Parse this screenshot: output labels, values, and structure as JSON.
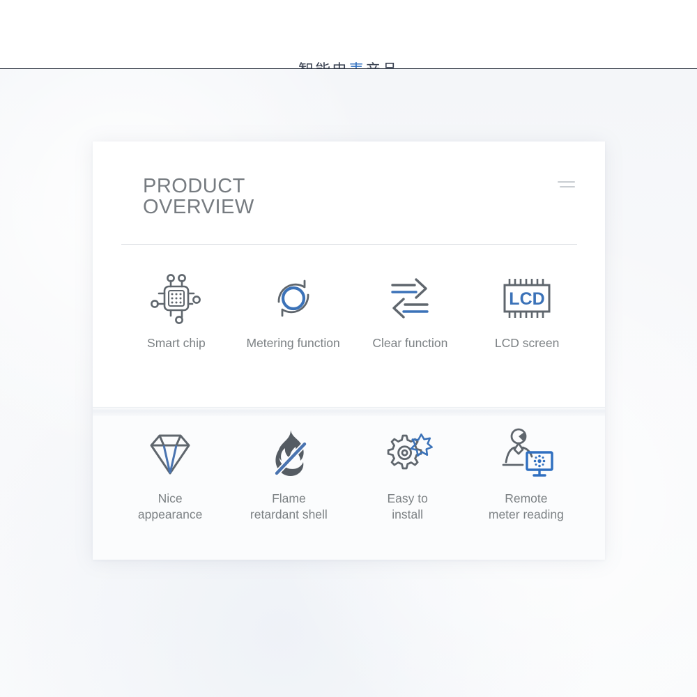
{
  "top_banner": {
    "text_prefix": "智能电",
    "text_highlight": "表",
    "text_suffix": "产品",
    "note": "cropped-banner"
  },
  "card": {
    "title_line_1": "PRODUCT",
    "title_line_2": "OVERVIEW",
    "menu_icon": "menu-icon",
    "colors": {
      "card_background": "#ffffff",
      "page_background": "#f7f8fa",
      "title_text": "#767b80",
      "label_text": "#7c8184",
      "divider": "#dcdfe3",
      "icon_gray": "#5f666d",
      "icon_blue": "#3b72b8",
      "accent_blue": "#2f6fc0"
    },
    "features_row_1": [
      {
        "label": "Smart chip",
        "icon": "smart-chip-icon"
      },
      {
        "label": "Metering function",
        "icon": "metering-function-icon"
      },
      {
        "label": "Clear function",
        "icon": "clear-function-icon"
      },
      {
        "label": "LCD screen",
        "icon": "lcd-screen-icon",
        "icon_text": "LCD"
      }
    ],
    "features_row_2": [
      {
        "label": "Nice\nappearance",
        "icon": "diamond-icon"
      },
      {
        "label": "Flame\nretardant shell",
        "icon": "flame-retardant-icon"
      },
      {
        "label": "Easy to\ninstall",
        "icon": "gears-icon"
      },
      {
        "label": "Remote\nmeter reading",
        "icon": "remote-meter-reading-icon"
      }
    ]
  }
}
